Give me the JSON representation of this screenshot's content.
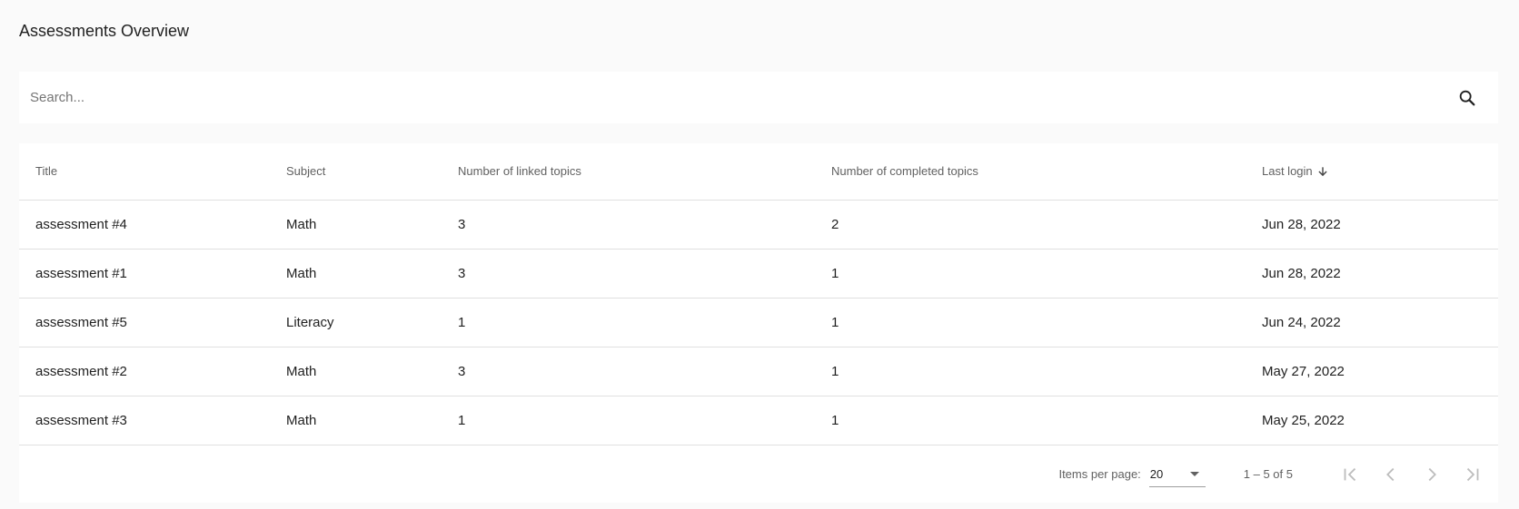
{
  "page": {
    "title": "Assessments Overview"
  },
  "search": {
    "placeholder": "Search...",
    "value": "",
    "icon": "search-icon"
  },
  "table": {
    "columns": [
      "Title",
      "Subject",
      "Number of linked topics",
      "Number of completed topics",
      "Last login"
    ],
    "sort": {
      "column": "Last login",
      "direction": "desc",
      "icon": "arrow-down-icon"
    },
    "rows": [
      {
        "title": "assessment #4",
        "subject": "Math",
        "linked": "3",
        "completed": "2",
        "last_login": "Jun 28, 2022"
      },
      {
        "title": "assessment #1",
        "subject": "Math",
        "linked": "3",
        "completed": "1",
        "last_login": "Jun 28, 2022"
      },
      {
        "title": "assessment #5",
        "subject": "Literacy",
        "linked": "1",
        "completed": "1",
        "last_login": "Jun 24, 2022"
      },
      {
        "title": "assessment #2",
        "subject": "Math",
        "linked": "3",
        "completed": "1",
        "last_login": "May 27, 2022"
      },
      {
        "title": "assessment #3",
        "subject": "Math",
        "linked": "1",
        "completed": "1",
        "last_login": "May 25, 2022"
      }
    ]
  },
  "paginator": {
    "items_per_page_label": "Items per page:",
    "items_per_page": "20",
    "range_label": "1 – 5 of 5",
    "buttons": [
      "first-page-icon",
      "previous-page-icon",
      "next-page-icon",
      "last-page-icon"
    ]
  },
  "colors": {
    "background": "#fafafa",
    "card": "#ffffff",
    "divider": "#e0e0e0",
    "disabled_icon": "#bdbdbd"
  }
}
